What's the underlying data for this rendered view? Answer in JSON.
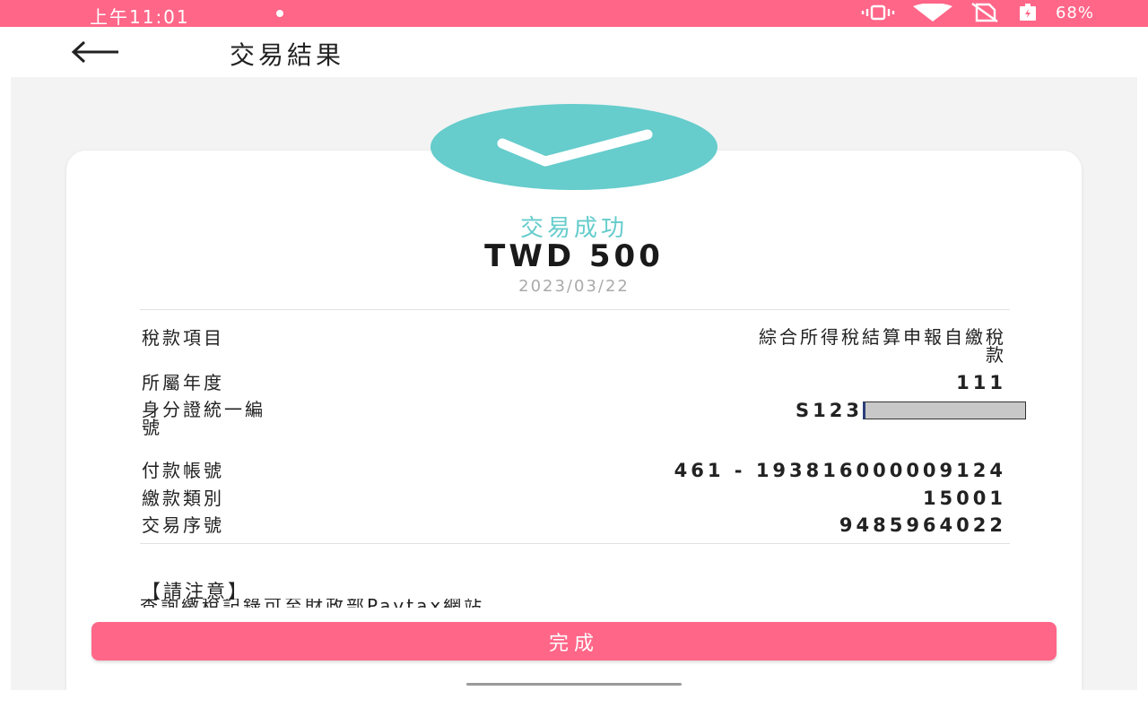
{
  "status_bar": {
    "time": "上午11:01",
    "battery": "68%",
    "icons": [
      "vibrate-icon",
      "wifi-icon",
      "no-sim-icon",
      "battery-icon"
    ],
    "color": "#ff6688"
  },
  "header": {
    "back_icon": "back-arrow-icon",
    "title": "交易結果"
  },
  "result": {
    "icon": "check-icon",
    "status": "交易成功",
    "amount": "TWD 500",
    "date": "2023/03/22",
    "accent_color": "#66cccc"
  },
  "details": {
    "tax_item_label": "稅款項目",
    "tax_item_value_line1": "綜合所得稅結算申報自繳稅",
    "tax_item_value_line2": "款",
    "year_label": "所屬年度",
    "year_value": "111",
    "id_label_line1": "身分證統一編",
    "id_label_line2": "號",
    "id_value": "S123",
    "account_label": "付款帳號",
    "account_value": "461 - 193816000009124",
    "category_label": "繳款類別",
    "category_value": "15001",
    "serial_label": "交易序號",
    "serial_value": "9485964022"
  },
  "notice": {
    "title": "【請注意】",
    "text": "查詢繳稅記錄可至財政部Paytax網站，"
  },
  "actions": {
    "done_label": "完成",
    "done_color": "#ff6688"
  }
}
